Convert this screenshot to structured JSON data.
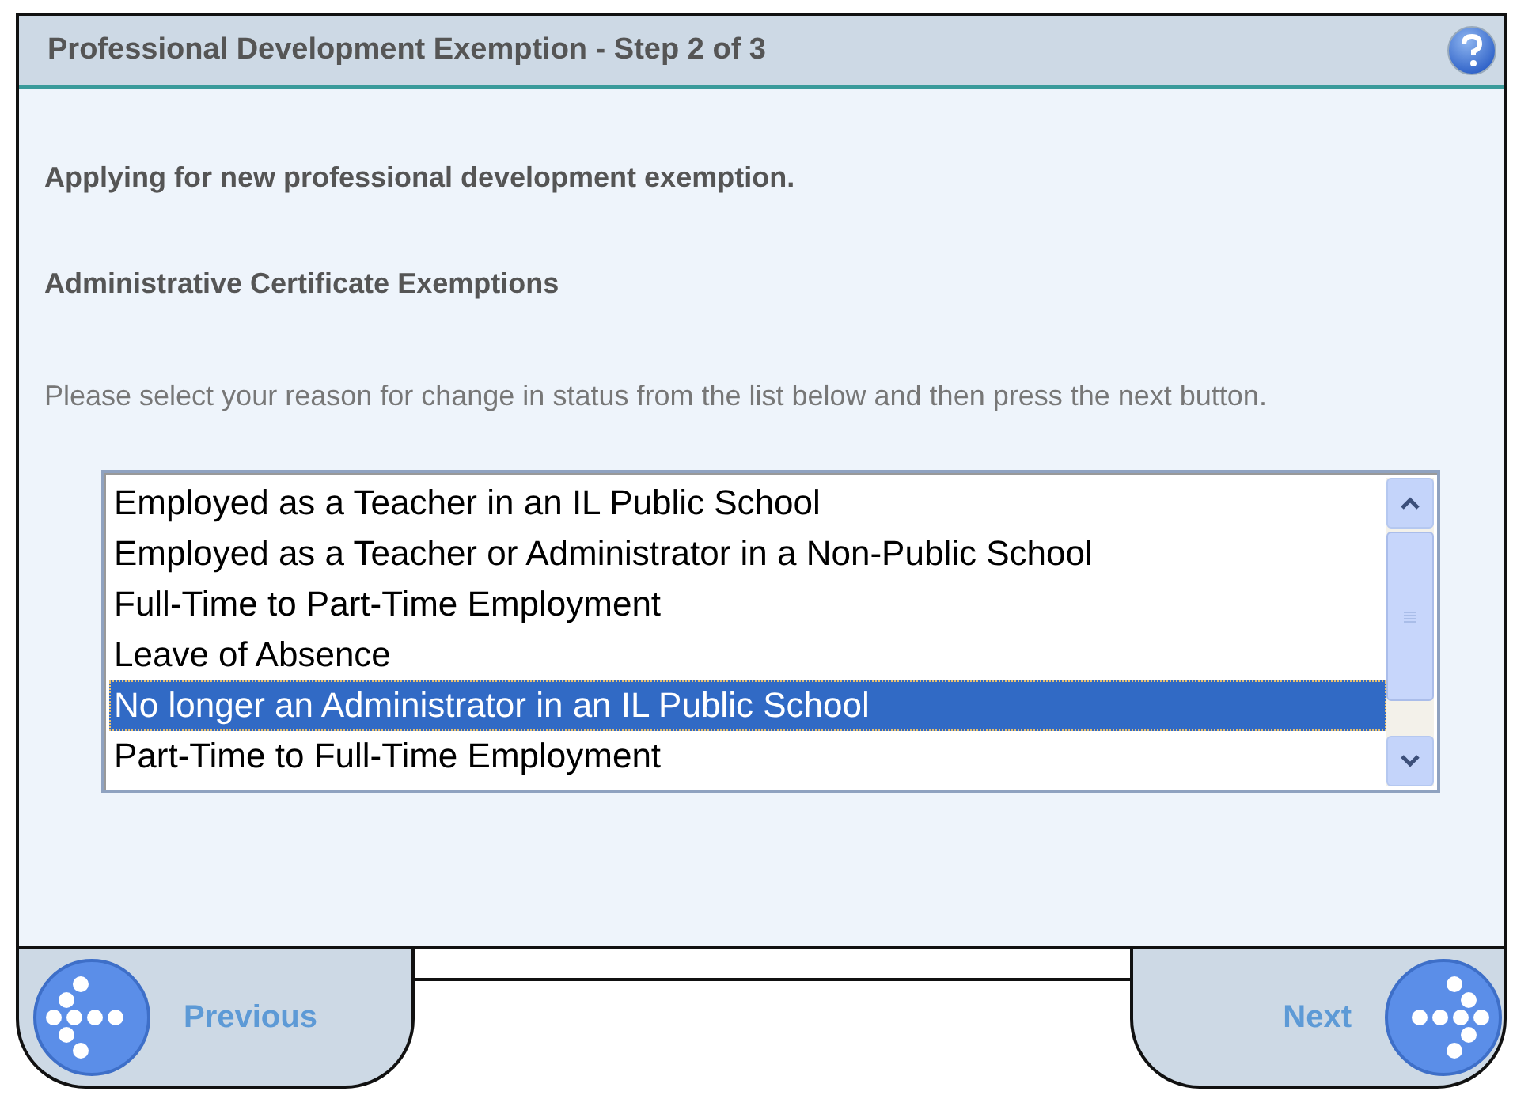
{
  "window": {
    "title": "Professional Development Exemption - Step 2 of 3"
  },
  "heading": "Applying for new professional development exemption.",
  "subheading": "Administrative Certificate Exemptions",
  "instructions": "Please select your reason for change in status from the list below and then press the next button.",
  "reasons": [
    {
      "label": "Employed as a Teacher in an IL Public School",
      "selected": false
    },
    {
      "label": "Employed as a Teacher or Administrator in a Non-Public School",
      "selected": false
    },
    {
      "label": "Full-Time to Part-Time Employment",
      "selected": false
    },
    {
      "label": "Leave of Absence",
      "selected": false
    },
    {
      "label": "No longer an Administrator in an IL Public School",
      "selected": true
    },
    {
      "label": "Part-Time to Full-Time Employment",
      "selected": false
    }
  ],
  "buttons": {
    "previous": "Previous",
    "next": "Next"
  }
}
